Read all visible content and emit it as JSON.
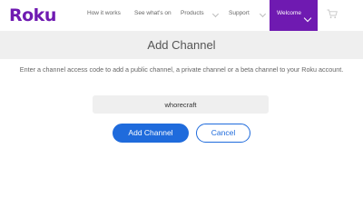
{
  "brand": {
    "logo_text": "Roku",
    "accent_color": "#6f1ab1"
  },
  "nav": {
    "items": [
      {
        "label": "How it works"
      },
      {
        "label": "See what's on"
      },
      {
        "label": "Products"
      },
      {
        "label": "Support"
      }
    ],
    "welcome_label": "Welcome"
  },
  "page": {
    "title": "Add Channel",
    "intro": "Enter a channel access code to add a public channel, a private channel or a beta channel to your Roku account."
  },
  "form": {
    "code_value": "whorecraft",
    "add_label": "Add Channel",
    "cancel_label": "Cancel",
    "button_color": "#1f6bdc"
  }
}
